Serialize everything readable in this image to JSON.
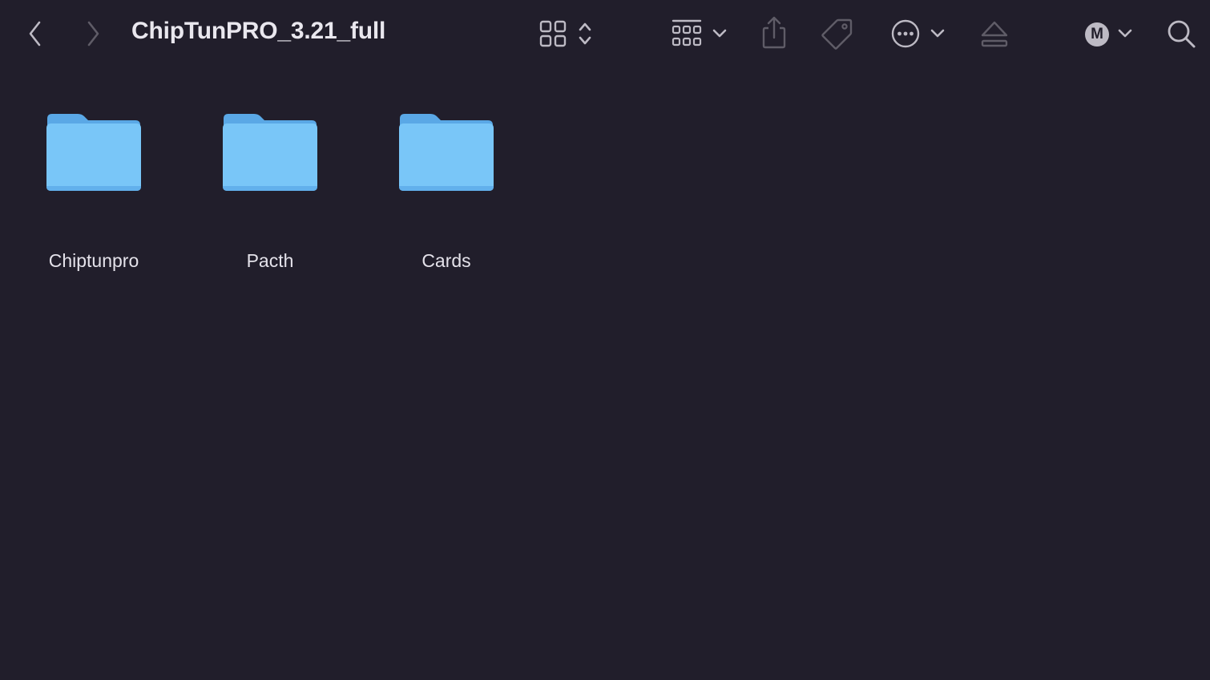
{
  "window": {
    "title": "ChipTunPRO_3.21_full"
  },
  "toolbar": {
    "icons": {
      "back": "chevron-left-icon",
      "forward": "chevron-right-icon",
      "view": "icon-grid-icon",
      "view_stepper": "up-down-chevron-icon",
      "group": "group-by-icon",
      "share": "share-icon",
      "tag": "tag-icon",
      "more": "ellipsis-circle-icon",
      "eject": "eject-icon",
      "account": "m-badge-icon",
      "search": "magnifying-glass-icon"
    },
    "account_letter": "M"
  },
  "files": [
    {
      "name": "Chiptunpro",
      "kind": "folder"
    },
    {
      "name": "Pacth",
      "kind": "folder"
    },
    {
      "name": "Cards",
      "kind": "folder"
    }
  ],
  "colors": {
    "background": "#211e2b",
    "icon_active": "#bdbac4",
    "icon_disabled": "#5f5c67",
    "folder_front": "#79c6f8",
    "folder_back": "#5aa8e6",
    "text": "#e4e2ea"
  }
}
